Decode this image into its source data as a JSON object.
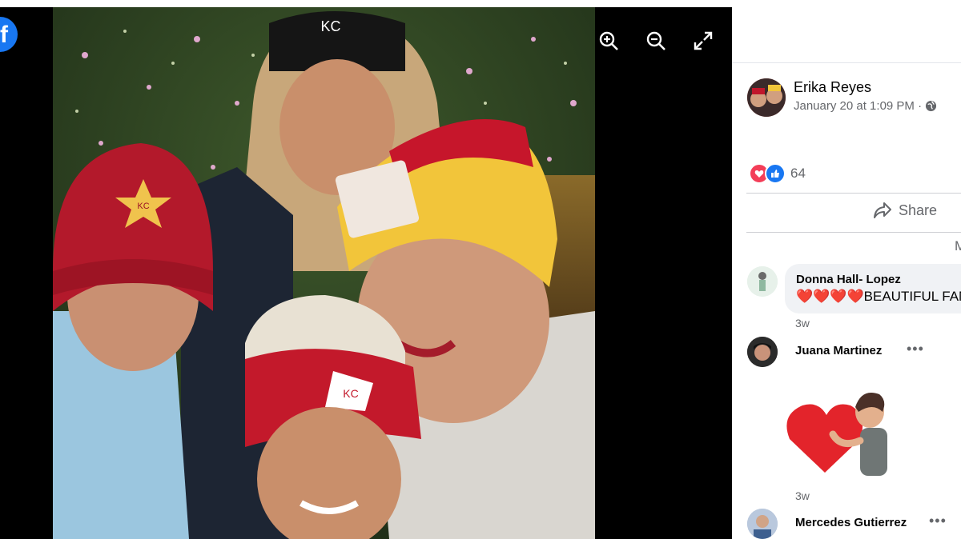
{
  "viewer": {
    "controls": [
      {
        "name": "zoom-in-icon"
      },
      {
        "name": "zoom-out-icon"
      },
      {
        "name": "fullscreen-icon"
      }
    ],
    "photo_caps": {
      "boy_hat_label": "KC",
      "girl_hat_label": "KC",
      "kid_hat_label": "KC"
    }
  },
  "post": {
    "author": "Erika Reyes",
    "timestamp": "January 20 at 1:09 PM ·",
    "reaction_count": "64",
    "share_label": "Share",
    "more_label": "M"
  },
  "comments": [
    {
      "author": "Donna Hall- Lopez",
      "text": "❤️❤️❤️❤️BEAUTIFUL FAMILY",
      "time": "3w"
    },
    {
      "author": "Juana Martinez",
      "text": "",
      "time": "3w"
    },
    {
      "author": "Mercedes Gutierrez",
      "text": "",
      "time": ""
    }
  ],
  "colors": {
    "facebook_blue": "#1877f2",
    "secondary_text": "#65676b",
    "comment_bg": "#f0f2f5",
    "love_red": "#f33e58"
  }
}
